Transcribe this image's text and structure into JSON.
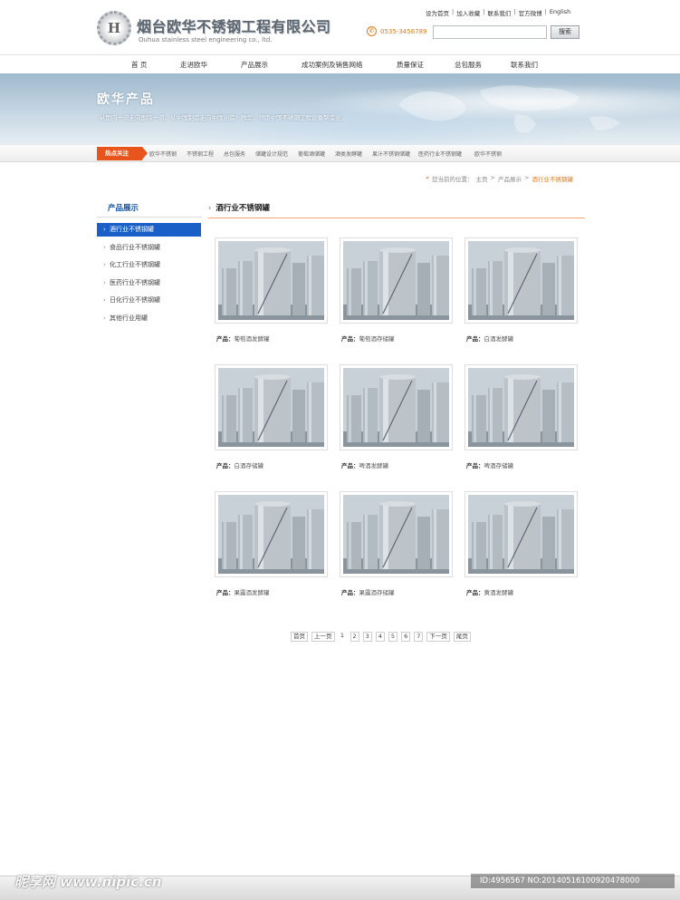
{
  "header": {
    "logo_letter": "H",
    "company_cn": "烟台欧华不锈钢工程有限公司",
    "company_en": "Ouhua stainless steel engineering co., ltd.",
    "toplinks": [
      "设为首页",
      "加入收藏",
      "联系我们",
      "官方微博",
      "English"
    ],
    "toplink_separator": "|",
    "phone": "0535-3456789",
    "search_placeholder": "",
    "search_button": "搜索"
  },
  "nav": [
    "首 页",
    "走进欧华",
    "产品展示",
    "成功案例及销售网络",
    "质量保证",
    "总包服务",
    "联系我们"
  ],
  "banner": {
    "title": "欧华产品",
    "slogan": "从国内一流走向国际一流，从中国制造走向中国创造！欧华，领跑中国不锈钢工程设备制造业。"
  },
  "hotbar": {
    "label": "热点关注",
    "items": [
      "欧华不锈钢",
      "不锈钢工程",
      "总包服务",
      "储罐设计规范",
      "葡萄酒储罐",
      "酒类发酵罐",
      "果汁不锈钢储罐",
      "医药行业不锈钢罐",
      "欧华不锈钢"
    ]
  },
  "breadcrumb": {
    "prefix": "您当前的位置：",
    "items": [
      "主页",
      "产品展示"
    ],
    "current": "酒行业不锈钢罐",
    "separator": ">"
  },
  "sidebar": {
    "title": "产品展示",
    "items": [
      "酒行业不锈钢罐",
      "食品行业不锈钢罐",
      "化工行业不锈钢罐",
      "医药行业不锈钢罐",
      "日化行业不锈钢罐",
      "其他行业用罐"
    ],
    "active_index": 0
  },
  "content": {
    "title": "酒行业不锈钢罐",
    "caption_prefix": "产品：",
    "products": [
      "葡萄酒发酵罐",
      "葡萄酒存储罐",
      "白酒发酵罐",
      "白酒存储罐",
      "啤酒发酵罐",
      "啤酒存储罐",
      "果露酒发酵罐",
      "果露酒存储罐",
      "黄酒发酵罐"
    ]
  },
  "pagination": {
    "first": "首页",
    "prev": "上一页",
    "pages": [
      "1",
      "2",
      "3",
      "4",
      "5",
      "6",
      "7"
    ],
    "next": "下一页",
    "last": "尾页"
  },
  "watermark": {
    "site": "昵享网 www.nipic.cn",
    "id": "ID:4956567 NO:20140516100920478000"
  },
  "colors": {
    "accent_orange": "#e8551c",
    "nav_blue": "#1a5fc8",
    "title_blue": "#1450a0"
  }
}
